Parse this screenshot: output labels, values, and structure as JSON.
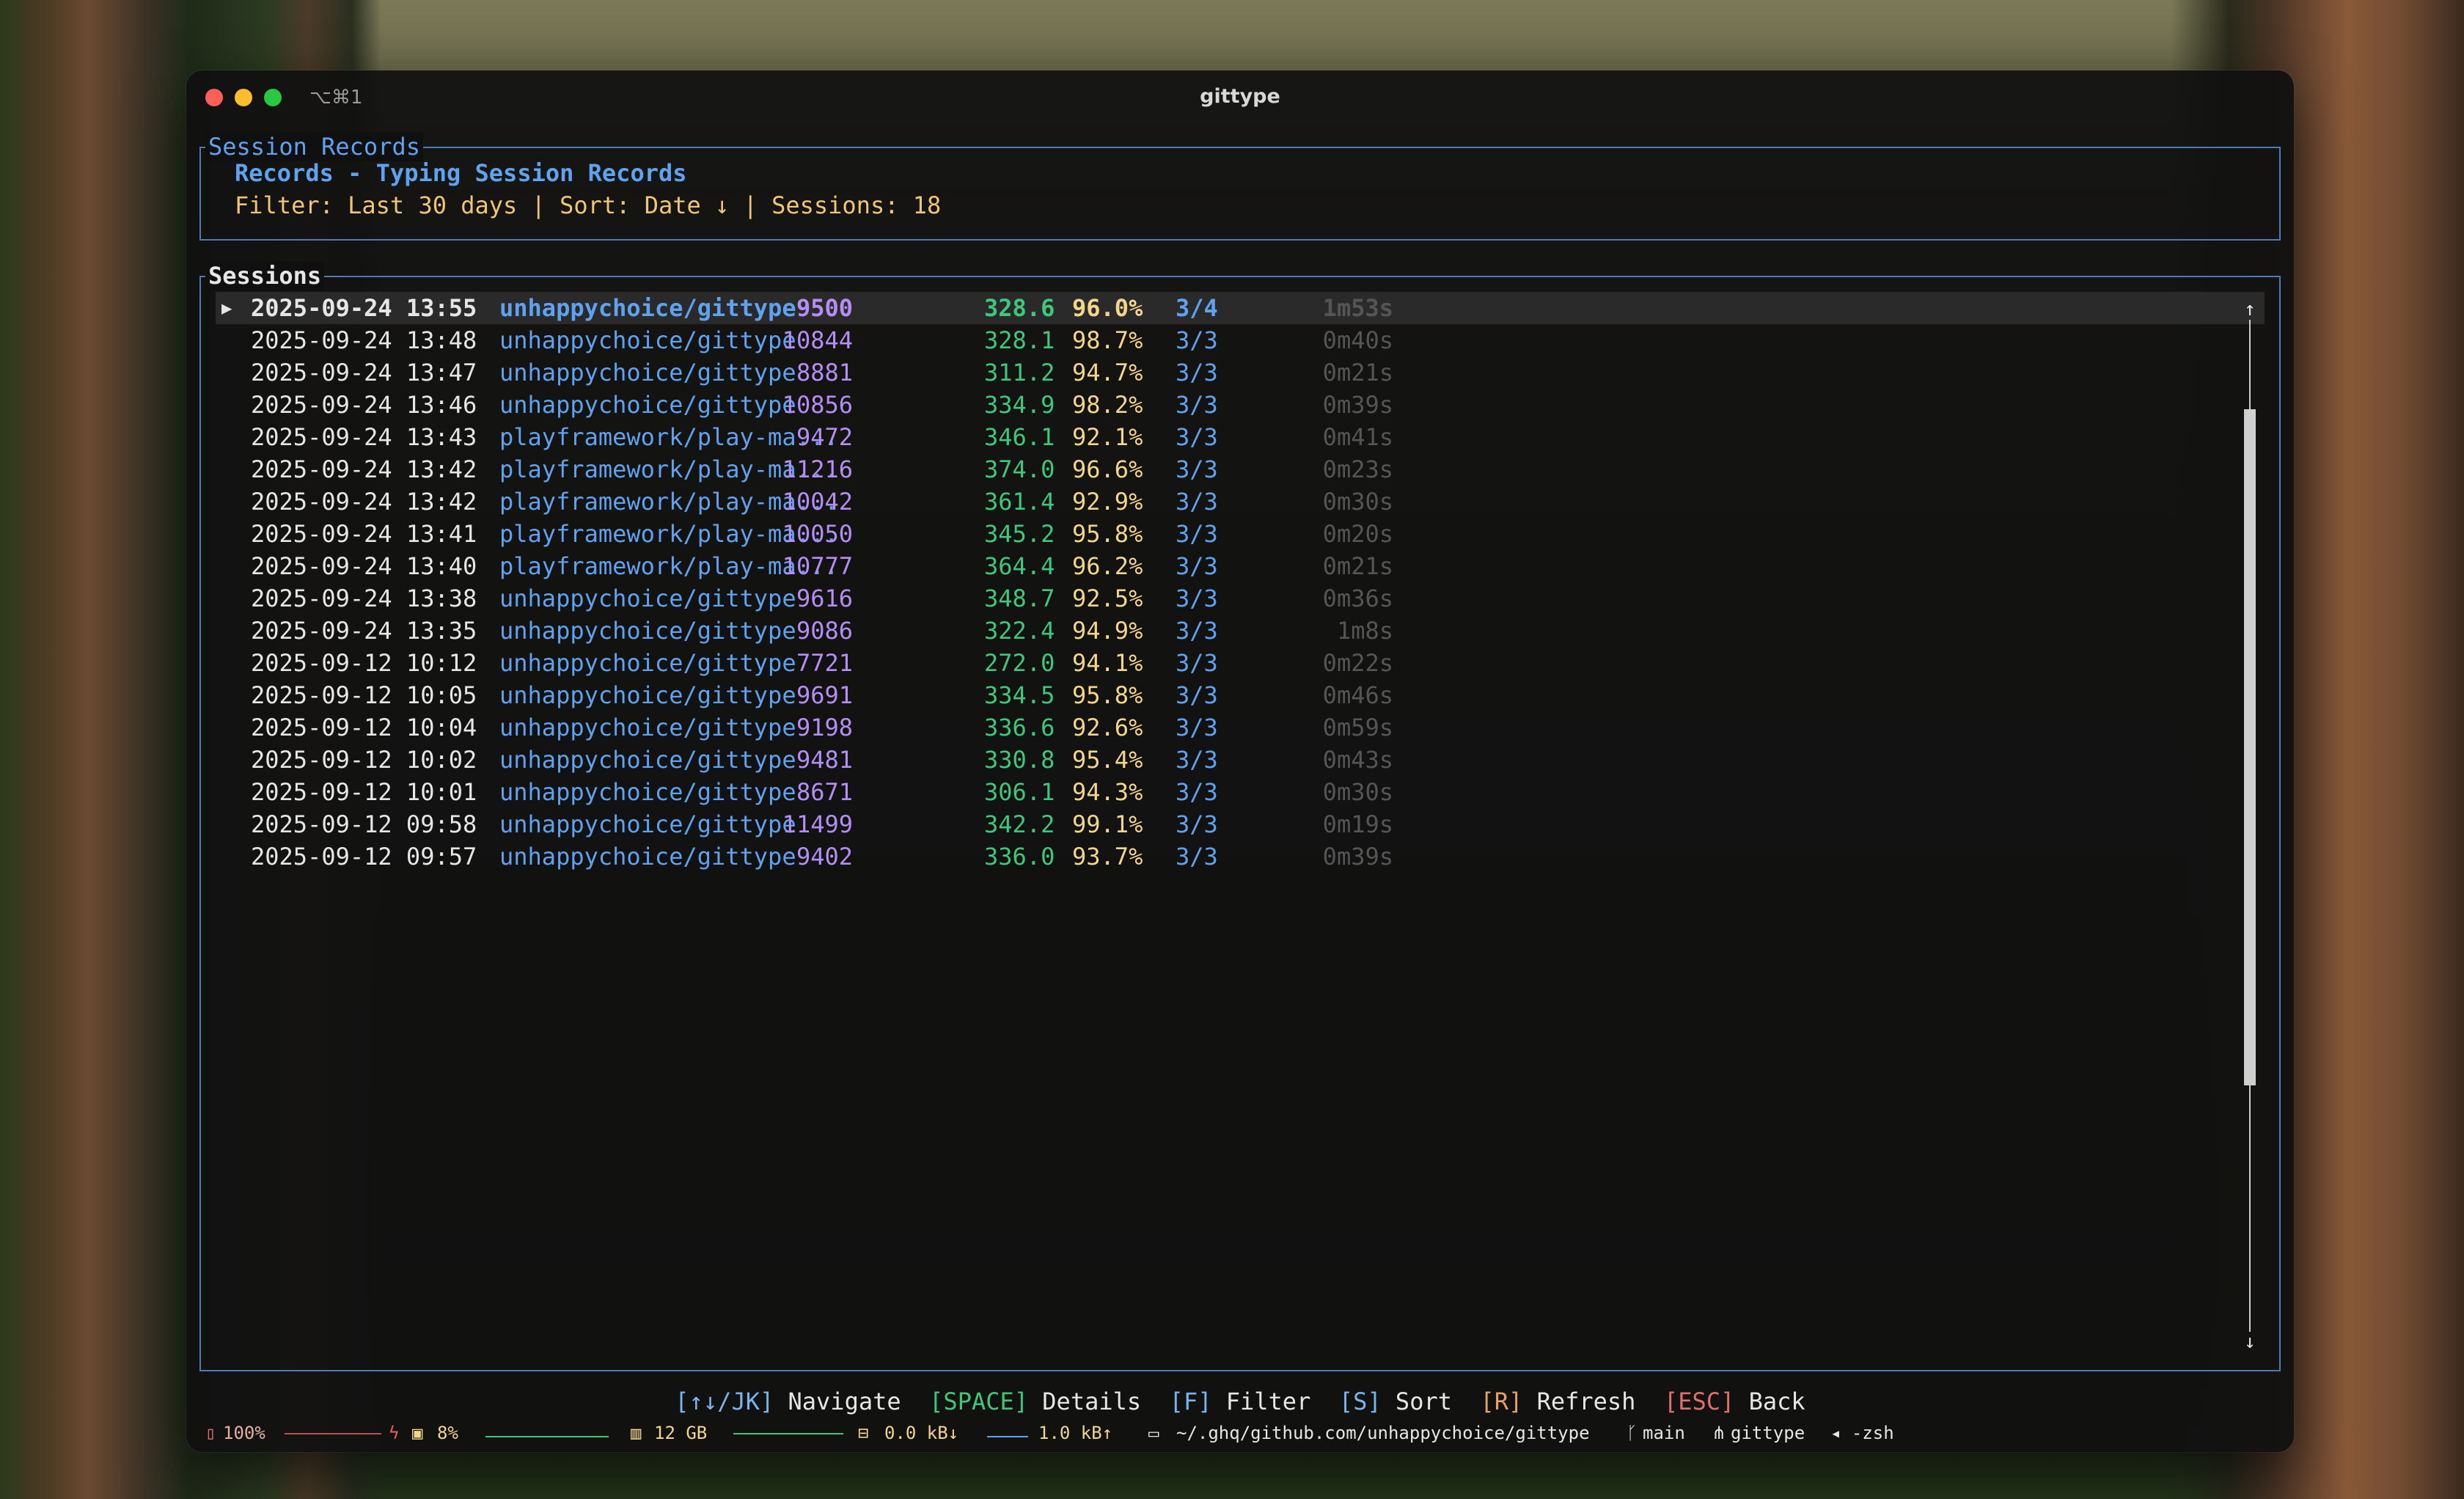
{
  "window": {
    "title": "gittype",
    "tab_shortcut": "⌥⌘1"
  },
  "header": {
    "box_title": "Session Records",
    "title": "Records - Typing Session Records",
    "filter_line": "Filter: Last 30 days | Sort: Date ↓ | Sessions: 18"
  },
  "sessions": {
    "box_title": "Sessions",
    "rows": [
      {
        "date": "2025-09-24 13:55",
        "repo": "unhappychoice/gittype",
        "count": "9500",
        "cpm": "328.6",
        "acc": "96.0%",
        "stages": "3/4",
        "dur": "1m53s",
        "selected": true
      },
      {
        "date": "2025-09-24 13:48",
        "repo": "unhappychoice/gittype",
        "count": "10844",
        "cpm": "328.1",
        "acc": "98.7%",
        "stages": "3/3",
        "dur": "0m40s"
      },
      {
        "date": "2025-09-24 13:47",
        "repo": "unhappychoice/gittype",
        "count": "8881",
        "cpm": "311.2",
        "acc": "94.7%",
        "stages": "3/3",
        "dur": "0m21s"
      },
      {
        "date": "2025-09-24 13:46",
        "repo": "unhappychoice/gittype",
        "count": "10856",
        "cpm": "334.9",
        "acc": "98.2%",
        "stages": "3/3",
        "dur": "0m39s"
      },
      {
        "date": "2025-09-24 13:43",
        "repo": "playframework/play-ma...",
        "count": "9472",
        "cpm": "346.1",
        "acc": "92.1%",
        "stages": "3/3",
        "dur": "0m41s"
      },
      {
        "date": "2025-09-24 13:42",
        "repo": "playframework/play-ma...",
        "count": "11216",
        "cpm": "374.0",
        "acc": "96.6%",
        "stages": "3/3",
        "dur": "0m23s"
      },
      {
        "date": "2025-09-24 13:42",
        "repo": "playframework/play-ma...",
        "count": "10042",
        "cpm": "361.4",
        "acc": "92.9%",
        "stages": "3/3",
        "dur": "0m30s"
      },
      {
        "date": "2025-09-24 13:41",
        "repo": "playframework/play-ma...",
        "count": "10050",
        "cpm": "345.2",
        "acc": "95.8%",
        "stages": "3/3",
        "dur": "0m20s"
      },
      {
        "date": "2025-09-24 13:40",
        "repo": "playframework/play-ma...",
        "count": "10777",
        "cpm": "364.4",
        "acc": "96.2%",
        "stages": "3/3",
        "dur": "0m21s"
      },
      {
        "date": "2025-09-24 13:38",
        "repo": "unhappychoice/gittype",
        "count": "9616",
        "cpm": "348.7",
        "acc": "92.5%",
        "stages": "3/3",
        "dur": "0m36s"
      },
      {
        "date": "2025-09-24 13:35",
        "repo": "unhappychoice/gittype",
        "count": "9086",
        "cpm": "322.4",
        "acc": "94.9%",
        "stages": "3/3",
        "dur": "1m8s"
      },
      {
        "date": "2025-09-12 10:12",
        "repo": "unhappychoice/gittype",
        "count": "7721",
        "cpm": "272.0",
        "acc": "94.1%",
        "stages": "3/3",
        "dur": "0m22s"
      },
      {
        "date": "2025-09-12 10:05",
        "repo": "unhappychoice/gittype",
        "count": "9691",
        "cpm": "334.5",
        "acc": "95.8%",
        "stages": "3/3",
        "dur": "0m46s"
      },
      {
        "date": "2025-09-12 10:04",
        "repo": "unhappychoice/gittype",
        "count": "9198",
        "cpm": "336.6",
        "acc": "92.6%",
        "stages": "3/3",
        "dur": "0m59s"
      },
      {
        "date": "2025-09-12 10:02",
        "repo": "unhappychoice/gittype",
        "count": "9481",
        "cpm": "330.8",
        "acc": "95.4%",
        "stages": "3/3",
        "dur": "0m43s"
      },
      {
        "date": "2025-09-12 10:01",
        "repo": "unhappychoice/gittype",
        "count": "8671",
        "cpm": "306.1",
        "acc": "94.3%",
        "stages": "3/3",
        "dur": "0m30s"
      },
      {
        "date": "2025-09-12 09:58",
        "repo": "unhappychoice/gittype",
        "count": "11499",
        "cpm": "342.2",
        "acc": "99.1%",
        "stages": "3/3",
        "dur": "0m19s"
      },
      {
        "date": "2025-09-12 09:57",
        "repo": "unhappychoice/gittype",
        "count": "9402",
        "cpm": "336.0",
        "acc": "93.7%",
        "stages": "3/3",
        "dur": "0m39s"
      }
    ],
    "scroll_up": "↑",
    "scroll_down": "↓"
  },
  "help": {
    "navigate_key": "[↑↓/JK]",
    "navigate_label": "Navigate",
    "details_key": "[SPACE]",
    "details_label": "Details",
    "filter_key": "[F]",
    "filter_label": "Filter",
    "sort_key": "[S]",
    "sort_label": "Sort",
    "refresh_key": "[R]",
    "refresh_label": "Refresh",
    "back_key": "[ESC]",
    "back_label": "Back"
  },
  "statusbar": {
    "battery": "100%",
    "cpu": "8%",
    "memory": "12 GB",
    "net_down": "0.0 kB↓",
    "net_up": "1.0 kB↑",
    "path": "~/.ghq/github.com/unhappychoice/gittype",
    "branch": "main",
    "session": "gittype",
    "shell": "◂ -zsh"
  },
  "colors": {
    "accent_blue": "#5fa2f0",
    "filter_yellow": "#f0c674",
    "count_purple": "#b48ef5",
    "cpm_green": "#3fc77a",
    "border": "#4b7ab5"
  }
}
